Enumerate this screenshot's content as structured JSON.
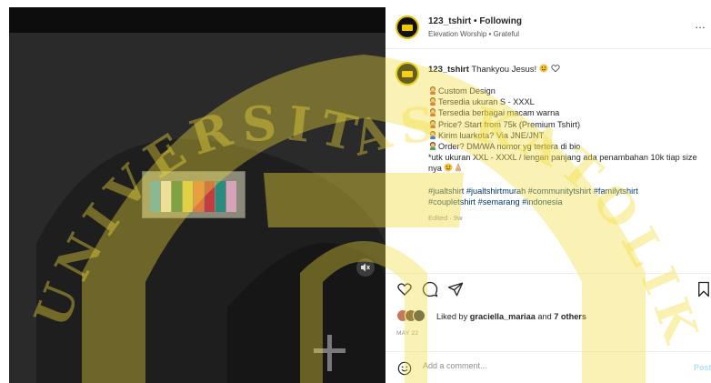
{
  "header": {
    "username": "123_tshirt",
    "separator": "•",
    "follow_state": "Following",
    "audio": "Elevation Worship • Grateful",
    "more": "…"
  },
  "caption": {
    "username": "123_tshirt",
    "first_line": " Thankyou Jesus!",
    "lines": [
      "Custom Design",
      "Tersedia ukuran S - XXXL",
      "Tersedia berbagai macam warna",
      "Price? Start from 75k (Premium Tshirt)",
      "Kirim luarkota? Via JNE/JNT",
      "Order? DM/WA nomor yg tertera di bio",
      "*utk ukuran XXL - XXXL / lengan panjang ada penambahan 10k tiap size nya"
    ],
    "hashtags_line1": "#jualtshirt #jualtshirtmurah #communitytshirt #familytshirt",
    "hashtags_line2": "#coupletshirt #semarang #indonesia",
    "edited": "Edited · 9w"
  },
  "likes": {
    "prefix": "Liked by ",
    "user": "graciella_mariaa",
    "middle": " and ",
    "others": "7 others"
  },
  "date": "MAY 22",
  "comment": {
    "placeholder": "Add a comment...",
    "post_label": "Post"
  },
  "watermark": {
    "text": "UNIVERSITAS KATOLIK"
  },
  "colors": {
    "accent_link": "#00376b",
    "watermark_gold": "#f2dc3c",
    "post_disabled": "#b2dffc"
  }
}
